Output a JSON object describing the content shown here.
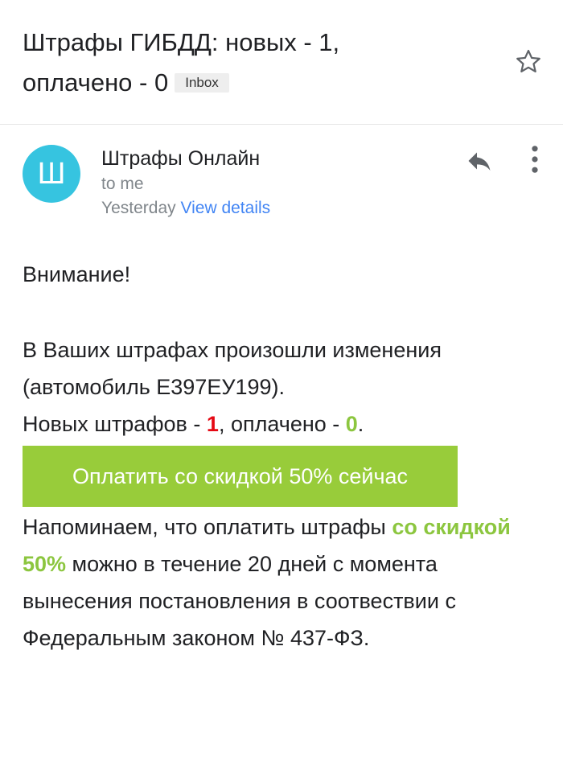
{
  "email": {
    "subject_line1": "Штрафы ГИБДД: новых - 1,",
    "subject_line2": "оплачено - 0",
    "label": "Inbox",
    "sender": {
      "initial": "Ш",
      "name": "Штрафы Онлайн",
      "recipient": "to me",
      "date": "Yesterday",
      "view_details": "View details"
    },
    "colors": {
      "avatar": "#36c4e0",
      "link": "#4285f4",
      "button": "#98cc3a",
      "green_text": "#8cc63f",
      "red_text": "#e50914"
    },
    "icons": {
      "star": "star-icon",
      "reply": "reply-icon",
      "more": "more-vert-icon"
    },
    "body": {
      "attention": "Внимание!",
      "line1": "В Ваших штрафах произошли изменения",
      "line2": "(автомобиль Е397ЕУ199).",
      "new_fines_prefix": "Новых штрафов - ",
      "new_fines_count": "1",
      "paid_prefix": ", оплачено - ",
      "paid_count": "0",
      "paid_suffix": ".",
      "button_label": "Оплатить со скидкой 50% сейчас",
      "reminder_prefix": "Напоминаем, что оплатить штрафы ",
      "reminder_highlight": "со скидкой 50%",
      "reminder_suffix": " можно в течение 20 дней с момента вынесения постановления в соотвествии с Федеральным законом № 437-ФЗ."
    }
  }
}
